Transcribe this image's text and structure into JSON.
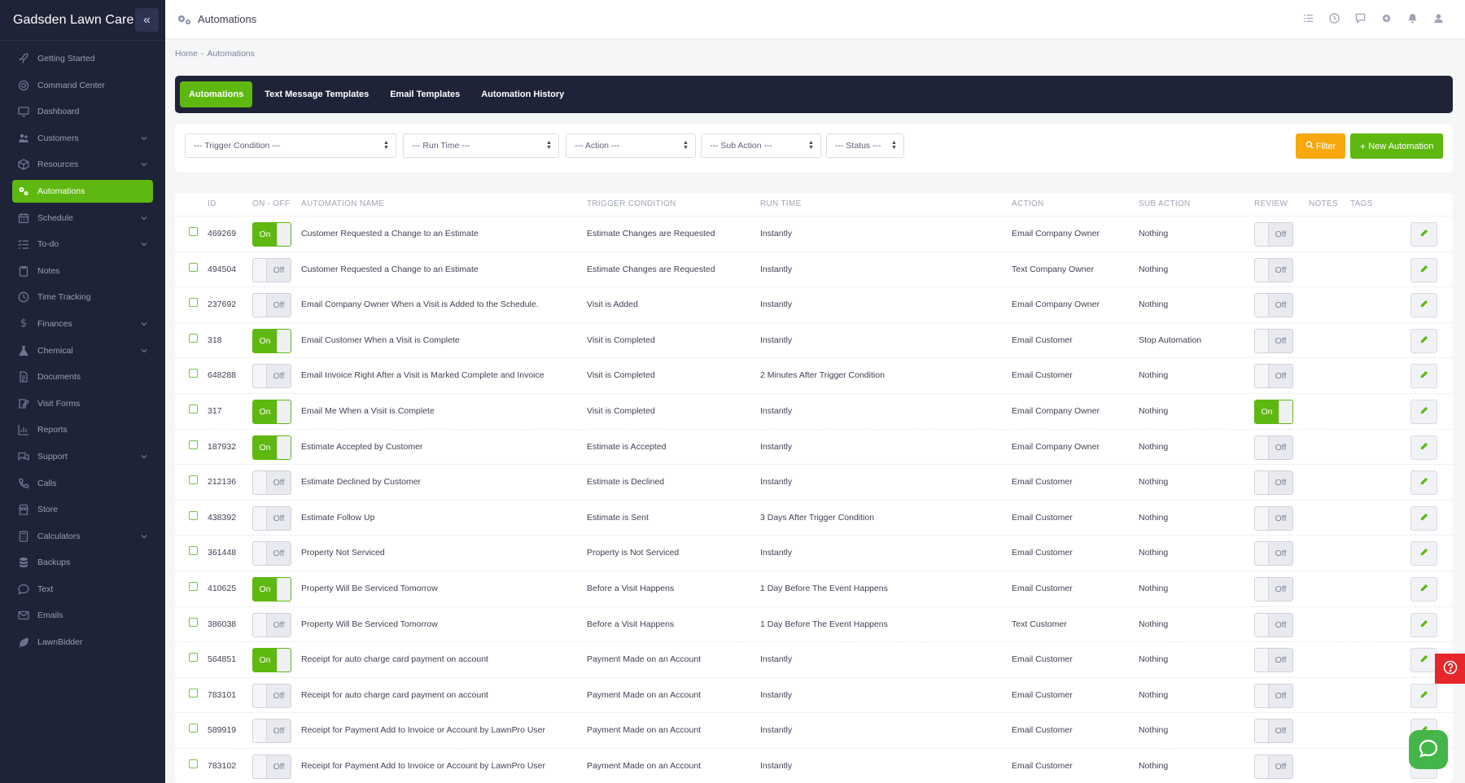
{
  "sidebar": {
    "title": "Gadsden Lawn Care",
    "collapse_icon": "double-chevron-left-icon",
    "items": [
      {
        "label": "Getting Started",
        "icon": "rocket-icon",
        "expandable": false,
        "active": false
      },
      {
        "label": "Command Center",
        "icon": "life-ring-icon",
        "expandable": false,
        "active": false
      },
      {
        "label": "Dashboard",
        "icon": "monitor-icon",
        "expandable": false,
        "active": false
      },
      {
        "label": "Customers",
        "icon": "users-icon",
        "expandable": true,
        "active": false
      },
      {
        "label": "Resources",
        "icon": "box-icon",
        "expandable": true,
        "active": false
      },
      {
        "label": "Automations",
        "icon": "gears-icon",
        "expandable": false,
        "active": true
      },
      {
        "label": "Schedule",
        "icon": "calendar-icon",
        "expandable": true,
        "active": false
      },
      {
        "label": "To-do",
        "icon": "checklist-icon",
        "expandable": true,
        "active": false
      },
      {
        "label": "Notes",
        "icon": "clipboard-icon",
        "expandable": false,
        "active": false
      },
      {
        "label": "Time Tracking",
        "icon": "clock-icon",
        "expandable": false,
        "active": false
      },
      {
        "label": "Finances",
        "icon": "dollar-icon",
        "expandable": true,
        "active": false
      },
      {
        "label": "Chemical",
        "icon": "flask-icon",
        "expandable": true,
        "active": false
      },
      {
        "label": "Documents",
        "icon": "document-icon",
        "expandable": false,
        "active": false
      },
      {
        "label": "Visit Forms",
        "icon": "form-icon",
        "expandable": false,
        "active": false
      },
      {
        "label": "Reports",
        "icon": "bar-chart-icon",
        "expandable": false,
        "active": false
      },
      {
        "label": "Support",
        "icon": "chat-bubbles-icon",
        "expandable": true,
        "active": false
      },
      {
        "label": "Calls",
        "icon": "phone-icon",
        "expandable": false,
        "active": false
      },
      {
        "label": "Store",
        "icon": "store-icon",
        "expandable": false,
        "active": false
      },
      {
        "label": "Calculators",
        "icon": "calculator-icon",
        "expandable": true,
        "active": false
      },
      {
        "label": "Backups",
        "icon": "database-icon",
        "expandable": false,
        "active": false
      },
      {
        "label": "Text",
        "icon": "message-icon",
        "expandable": false,
        "active": false
      },
      {
        "label": "Emails",
        "icon": "envelope-icon",
        "expandable": false,
        "active": false
      },
      {
        "label": "LawnBidder",
        "icon": "leaf-icon",
        "expandable": false,
        "active": false
      }
    ]
  },
  "header": {
    "title": "Automations",
    "icon": "gears-icon",
    "actions": [
      "tasks-icon",
      "clock-icon",
      "chat-icon",
      "gear-icon",
      "bell-icon",
      "user-icon"
    ]
  },
  "breadcrumb": {
    "home": "Home",
    "separator": "-",
    "current": "Automations"
  },
  "tabs": [
    {
      "label": "Automations",
      "active": true
    },
    {
      "label": "Text Message Templates",
      "active": false
    },
    {
      "label": "Email Templates",
      "active": false
    },
    {
      "label": "Automation History",
      "active": false
    }
  ],
  "filters": {
    "trigger_condition": "--- Trigger Condition ---",
    "run_time": "--- Run Time ---",
    "action": "--- Action ---",
    "sub_action": "--- Sub Action ---",
    "status": "--- Status ---",
    "filter_button": "Filter",
    "new_button": "New Automation"
  },
  "table": {
    "columns": {
      "id": "ID",
      "on_off": "ON - OFF",
      "name": "AUTOMATION NAME",
      "trigger": "TRIGGER CONDITION",
      "run_time": "RUN TIME",
      "action": "ACTION",
      "sub_action": "SUB ACTION",
      "review": "REVIEW",
      "notes": "NOTES",
      "tags": "TAGS"
    },
    "on_label": "On",
    "off_label": "Off",
    "rows": [
      {
        "id": "469269",
        "on": true,
        "name": "Customer Requested a Change to an Estimate",
        "trigger": "Estimate Changes are Requested",
        "run_time": "Instantly",
        "action": "Email Company Owner",
        "sub_action": "Nothing",
        "review": false
      },
      {
        "id": "494504",
        "on": false,
        "name": "Customer Requested a Change to an Estimate",
        "trigger": "Estimate Changes are Requested",
        "run_time": "Instantly",
        "action": "Text Company Owner",
        "sub_action": "Nothing",
        "review": false
      },
      {
        "id": "237692",
        "on": false,
        "name": "Email Company Owner When a Visit is Added to the Schedule.",
        "trigger": "Visit is Added",
        "run_time": "Instantly",
        "action": "Email Company Owner",
        "sub_action": "Nothing",
        "review": false
      },
      {
        "id": "318",
        "on": true,
        "name": "Email Customer When a Visit is Complete",
        "trigger": "Visit is Completed",
        "run_time": "Instantly",
        "action": "Email Customer",
        "sub_action": "Stop Automation",
        "review": false
      },
      {
        "id": "648288",
        "on": false,
        "name": "Email Invoice Right After a Visit is Marked Complete and Invoice",
        "trigger": "Visit is Completed",
        "run_time": "2 Minutes After Trigger Condition",
        "action": "Email Customer",
        "sub_action": "Nothing",
        "review": false
      },
      {
        "id": "317",
        "on": true,
        "name": "Email Me When a Visit is Complete",
        "trigger": "Visit is Completed",
        "run_time": "Instantly",
        "action": "Email Company Owner",
        "sub_action": "Nothing",
        "review": true
      },
      {
        "id": "187932",
        "on": true,
        "name": "Estimate Accepted by Customer",
        "trigger": "Estimate is Accepted",
        "run_time": "Instantly",
        "action": "Email Company Owner",
        "sub_action": "Nothing",
        "review": false
      },
      {
        "id": "212136",
        "on": false,
        "name": "Estimate Declined by Customer",
        "trigger": "Estimate is Declined",
        "run_time": "Instantly",
        "action": "Email Customer",
        "sub_action": "Nothing",
        "review": false
      },
      {
        "id": "438392",
        "on": false,
        "name": "Estimate Follow Up",
        "trigger": "Estimate is Sent",
        "run_time": "3 Days After Trigger Condition",
        "action": "Email Customer",
        "sub_action": "Nothing",
        "review": false
      },
      {
        "id": "361448",
        "on": false,
        "name": "Property Not Serviced",
        "trigger": "Property is Not Serviced",
        "run_time": "Instantly",
        "action": "Email Customer",
        "sub_action": "Nothing",
        "review": false
      },
      {
        "id": "410625",
        "on": true,
        "name": "Property Will Be Serviced Tomorrow",
        "trigger": "Before a Visit Happens",
        "run_time": "1 Day Before The Event Happens",
        "action": "Email Customer",
        "sub_action": "Nothing",
        "review": false
      },
      {
        "id": "386038",
        "on": false,
        "name": "Property Will Be Serviced Tomorrow",
        "trigger": "Before a Visit Happens",
        "run_time": "1 Day Before The Event Happens",
        "action": "Text Customer",
        "sub_action": "Nothing",
        "review": false
      },
      {
        "id": "564851",
        "on": true,
        "name": "Receipt for auto charge card payment on account",
        "trigger": "Payment Made on an Account",
        "run_time": "Instantly",
        "action": "Email Customer",
        "sub_action": "Nothing",
        "review": false
      },
      {
        "id": "783101",
        "on": false,
        "name": "Receipt for auto charge card payment on account",
        "trigger": "Payment Made on an Account",
        "run_time": "Instantly",
        "action": "Email Customer",
        "sub_action": "Nothing",
        "review": false
      },
      {
        "id": "589919",
        "on": false,
        "name": "Receipt for Payment Add to Invoice or Account by LawnPro User",
        "trigger": "Payment Made on an Account",
        "run_time": "Instantly",
        "action": "Email Customer",
        "sub_action": "Nothing",
        "review": false
      },
      {
        "id": "783102",
        "on": false,
        "name": "Receipt for Payment Add to Invoice or Account by LawnPro User",
        "trigger": "Payment Made on an Account",
        "run_time": "Instantly",
        "action": "Email Customer",
        "sub_action": "Nothing",
        "review": false
      }
    ]
  },
  "floating": {
    "help": "help-icon",
    "chat": "chat-icon"
  },
  "colors": {
    "sidebar_bg": "#1e2337",
    "accent_green": "#5fb80f",
    "filter_orange": "#f6a80c",
    "help_red": "#e5262b"
  }
}
